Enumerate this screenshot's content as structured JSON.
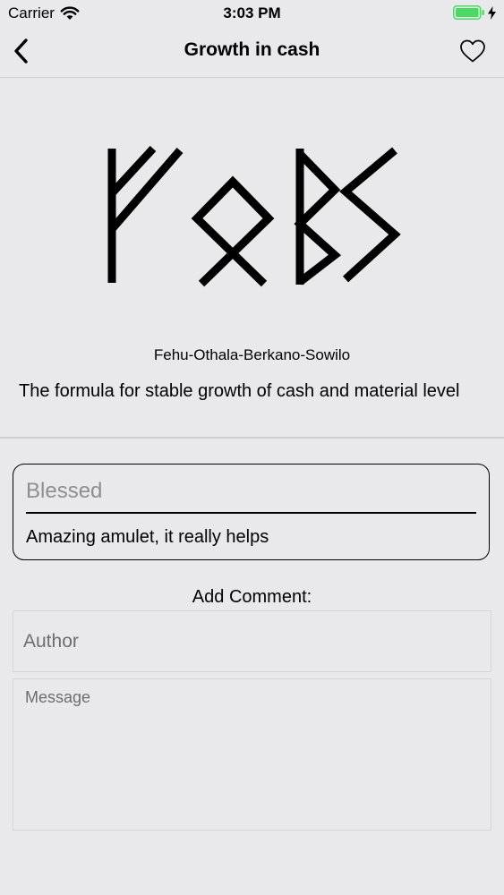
{
  "status_bar": {
    "carrier": "Carrier",
    "time": "3:03 PM",
    "battery_color": "#4CD964"
  },
  "nav": {
    "title": "Growth in cash",
    "back_icon": "chevron-left-icon",
    "favorite_icon": "heart-outline-icon"
  },
  "rune": {
    "name": "Fehu-Othala-Berkano-Sowilo",
    "description": "The formula for stable growth of cash and material level"
  },
  "review": {
    "author": "Blessed",
    "text": "Amazing amulet, it really helps"
  },
  "comment_form": {
    "heading": "Add Comment:",
    "author_placeholder": "Author",
    "message_placeholder": "Message"
  }
}
